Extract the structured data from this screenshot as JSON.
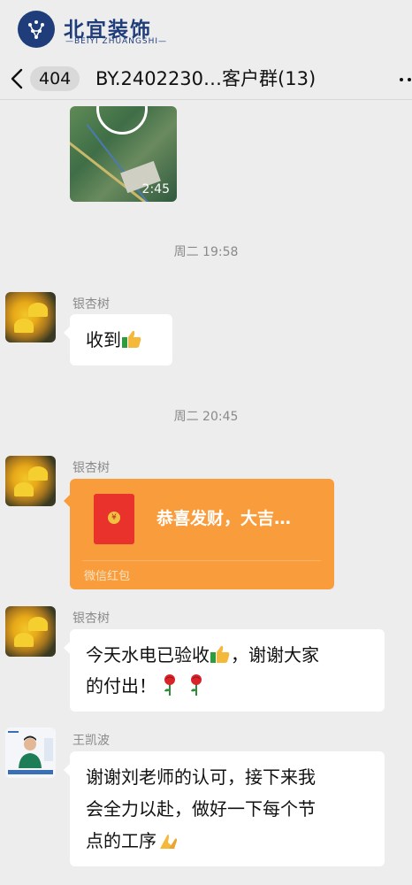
{
  "logo": {
    "title": "北宜装饰",
    "subtitle": "—BEIYI ZHUANGSHI—"
  },
  "nav": {
    "unread_count": "404",
    "title": "BY.2402230…客户群(13)"
  },
  "video": {
    "duration": "2:45"
  },
  "messages": [
    {
      "time": "周二 19:58",
      "sender": "银杏树",
      "text": "收到"
    },
    {
      "time": "周二 20:45",
      "sender": "银杏树",
      "red_packet": {
        "greeting": "恭喜发财，大吉…",
        "label": "微信红包"
      }
    },
    {
      "sender": "银杏树",
      "text_a": "今天水电已验收",
      "text_b": "，谢谢大家",
      "text_c": "的付出！"
    },
    {
      "sender": "王凯波",
      "line1": "谢谢刘老师的认可，接下来我",
      "line2": "会全力以赴，做好一下每个节",
      "line3": "点的工序"
    }
  ],
  "icons": [
    "back-chevron-icon",
    "more-icon",
    "play-icon",
    "thumbs-up-icon",
    "rose-icon",
    "folded-hands-icon",
    "red-packet-icon"
  ],
  "colors": {
    "background": "#ededed",
    "bubble": "#ffffff",
    "red_packet": "#f99c3b",
    "brand": "#1f3d7a"
  }
}
